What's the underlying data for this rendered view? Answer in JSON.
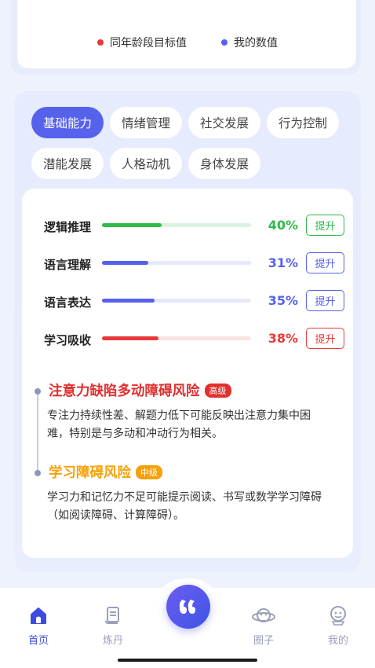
{
  "legend": [
    {
      "label": "同年龄段目标值",
      "color": "#e8393a"
    },
    {
      "label": "我的数值",
      "color": "#5661ec"
    }
  ],
  "tabs": [
    {
      "label": "基础能力",
      "active": true
    },
    {
      "label": "情绪管理",
      "active": false
    },
    {
      "label": "社交发展",
      "active": false
    },
    {
      "label": "行为控制",
      "active": false
    },
    {
      "label": "潜能发展",
      "active": false
    },
    {
      "label": "人格动机",
      "active": false
    },
    {
      "label": "身体发展",
      "active": false
    }
  ],
  "bars": [
    {
      "label": "逻辑推理",
      "pct_text": "40%",
      "value": 0.4,
      "color": "#2fba48",
      "track": "#dcf2e0",
      "button": "提升"
    },
    {
      "label": "语言理解",
      "pct_text": "31%",
      "value": 0.31,
      "color": "#5661ec",
      "track": "#e6e9fb",
      "button": "提升"
    },
    {
      "label": "语言表达",
      "pct_text": "35%",
      "value": 0.35,
      "color": "#5661ec",
      "track": "#e6e9fb",
      "button": "提升"
    },
    {
      "label": "学习吸收",
      "pct_text": "38%",
      "value": 0.38,
      "color": "#e8393a",
      "track": "#fbe3e3",
      "button": "提升"
    }
  ],
  "risks": [
    {
      "title": "注意力缺陷多动障碍风险",
      "badge": "高级",
      "color": "#e0302f",
      "desc": "专注力持续性差、解题力低下可能反映出注意力集中困难，特别是与多动和冲动行为相关。"
    },
    {
      "title": "学习障碍风险",
      "badge": "中级",
      "color": "#f5a20a",
      "desc": "学习力和记忆力不足可能提示阅读、书写或数学学习障碍（如阅读障碍、计算障碍）。"
    }
  ],
  "nav": [
    {
      "label": "首页",
      "icon": "home-icon",
      "active": true
    },
    {
      "label": "炼丹",
      "icon": "scroll-icon",
      "active": false
    },
    {
      "label": "",
      "icon": "quote-icon",
      "active": false
    },
    {
      "label": "圈子",
      "icon": "planet-icon",
      "active": false
    },
    {
      "label": "我的",
      "icon": "robot-face-icon",
      "active": false
    }
  ],
  "colors": {
    "accent": "#5661ec",
    "nav_active": "#3d4be0",
    "nav_inactive": "#9aa0b8"
  }
}
